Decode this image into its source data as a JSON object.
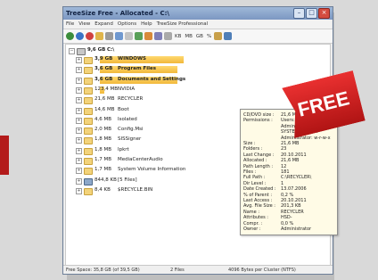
{
  "window": {
    "title": "TreeSize Free - Allocated - C:\\"
  },
  "menu": [
    "File",
    "View",
    "Expand",
    "Options",
    "Help",
    "TreeSize Professional"
  ],
  "toolbar": {
    "labels": [
      "KB",
      "MB",
      "GB",
      "%"
    ]
  },
  "tree": {
    "root": {
      "size": "9,6 GB",
      "name": "C:\\"
    },
    "rows": [
      {
        "size": "3,9 GB",
        "name": "WINDOWS",
        "bold": true,
        "fill": 0.41
      },
      {
        "size": "3,6 GB",
        "name": "Program Files",
        "bold": true,
        "fill": 0.38
      },
      {
        "size": "3,6 GB",
        "name": "Documents and Settings",
        "bold": true,
        "fill": 0.38
      },
      {
        "size": "123,4 MB",
        "name": "NVIDIA",
        "bold": false,
        "fill": 0.02
      },
      {
        "size": "21,6 MB",
        "name": "RECYCLER",
        "bold": false,
        "fill": 0
      },
      {
        "size": "14,6 MB",
        "name": "Boot",
        "bold": false,
        "fill": 0
      },
      {
        "size": "4,6 MB",
        "name": "Isolated",
        "bold": false,
        "fill": 0
      },
      {
        "size": "2,0 MB",
        "name": "Config.Msi",
        "bold": false,
        "fill": 0
      },
      {
        "size": "1,8 MB",
        "name": "SISSigner",
        "bold": false,
        "fill": 0
      },
      {
        "size": "1,8 MB",
        "name": "Ipkrt",
        "bold": false,
        "fill": 0
      },
      {
        "size": "1,7 MB",
        "name": "MediaCenterAudio",
        "bold": false,
        "fill": 0
      },
      {
        "size": "1,7 MB",
        "name": "System Volume Information",
        "bold": false,
        "fill": 0
      },
      {
        "size": "844,8 KB",
        "name": "[5 Files]",
        "bold": false,
        "fill": 0
      },
      {
        "size": "8,4 KB",
        "name": "$RECYCLE.BIN",
        "bold": false,
        "fill": 0
      }
    ]
  },
  "tooltip": [
    {
      "k": "CD/DVD size :",
      "v": "21,6 MB"
    },
    {
      "k": "Permissions :",
      "v": "Users: w-r-w-x"
    },
    {
      "k": "",
      "v": "Administrators: w-r-w-x"
    },
    {
      "k": "",
      "v": "SYSTEM: w-r-w-x"
    },
    {
      "k": "",
      "v": "Administrator: w-r-w-x"
    },
    {
      "k": "Size :",
      "v": "21,6 MB"
    },
    {
      "k": "Folders :",
      "v": "23"
    },
    {
      "k": "Last Change :",
      "v": "20.10.2011"
    },
    {
      "k": "Allocated :",
      "v": "21,6 MB"
    },
    {
      "k": "Path Length :",
      "v": "12"
    },
    {
      "k": "Files :",
      "v": "181"
    },
    {
      "k": "Full Path :",
      "v": "C:\\RECYCLER\\"
    },
    {
      "k": "Dir Level :",
      "v": "1"
    },
    {
      "k": "Date Created :",
      "v": "13.07.2006"
    },
    {
      "k": "% of Parent :",
      "v": "0,2 %"
    },
    {
      "k": "Last Access :",
      "v": "20.10.2011"
    },
    {
      "k": "Avg. File Size :",
      "v": "201,3 KB"
    },
    {
      "k": "Name :",
      "v": "RECYCLER"
    },
    {
      "k": "Attributes :",
      "v": "HSD-"
    },
    {
      "k": "Compr. :",
      "v": "0,0 %"
    },
    {
      "k": "Owner :",
      "v": "Administrator"
    }
  ],
  "status": {
    "free": "Free Space: 35,8 GB (of 39,5 GB)",
    "files": "2 Files",
    "cluster": "4096 Bytes per Cluster (NTFS)"
  },
  "badge": {
    "text": "FREE"
  },
  "colors": {
    "badge": "#c91e1e",
    "bar": "#f4c04b",
    "title": "#7b97c2"
  }
}
